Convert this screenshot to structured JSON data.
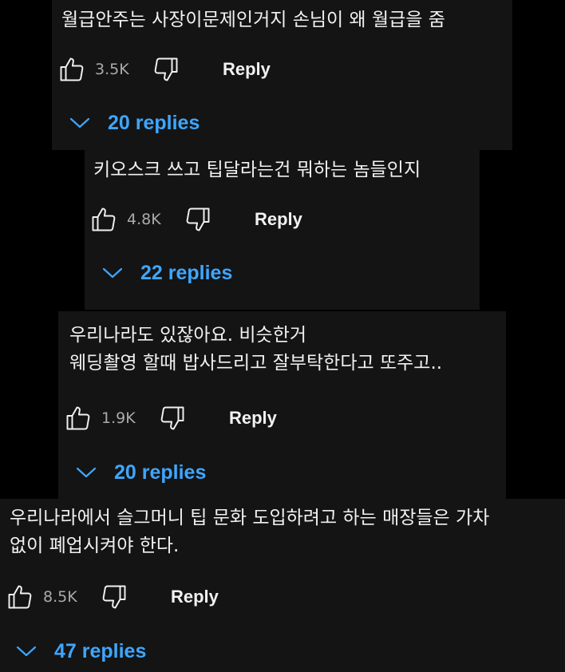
{
  "comments": [
    {
      "lines": [
        "월급안주는 사장이문제인거지 손님이 왜 월급을 줌"
      ],
      "likes": "3.5K",
      "reply_label": "Reply",
      "replies_label": "20 replies"
    },
    {
      "lines": [
        "키오스크 쓰고 팁달라는건 뭐하는 놈들인지"
      ],
      "likes": "4.8K",
      "reply_label": "Reply",
      "replies_label": "22 replies"
    },
    {
      "lines": [
        "우리나라도 있잖아요. 비슷한거",
        "웨딩촬영 할때 밥사드리고 잘부탁한다고 또주고.."
      ],
      "likes": "1.9K",
      "reply_label": "Reply",
      "replies_label": "20 replies"
    },
    {
      "lines": [
        "우리나라에서 슬그머니 팁 문화 도입하려고 하는 매장들은 가차",
        "없이 폐업시켜야 한다."
      ],
      "likes": "8.5K",
      "reply_label": "Reply",
      "replies_label": "47 replies"
    }
  ],
  "icons": {
    "like": "thumbs-up-icon",
    "dislike": "thumbs-down-icon",
    "expand": "chevron-down-icon"
  },
  "colors": {
    "card_background": "#141414",
    "page_background": "#000000",
    "text": "#f1f1f1",
    "count_text": "#aaaaaa",
    "replies_link": "#3ea6ff"
  }
}
